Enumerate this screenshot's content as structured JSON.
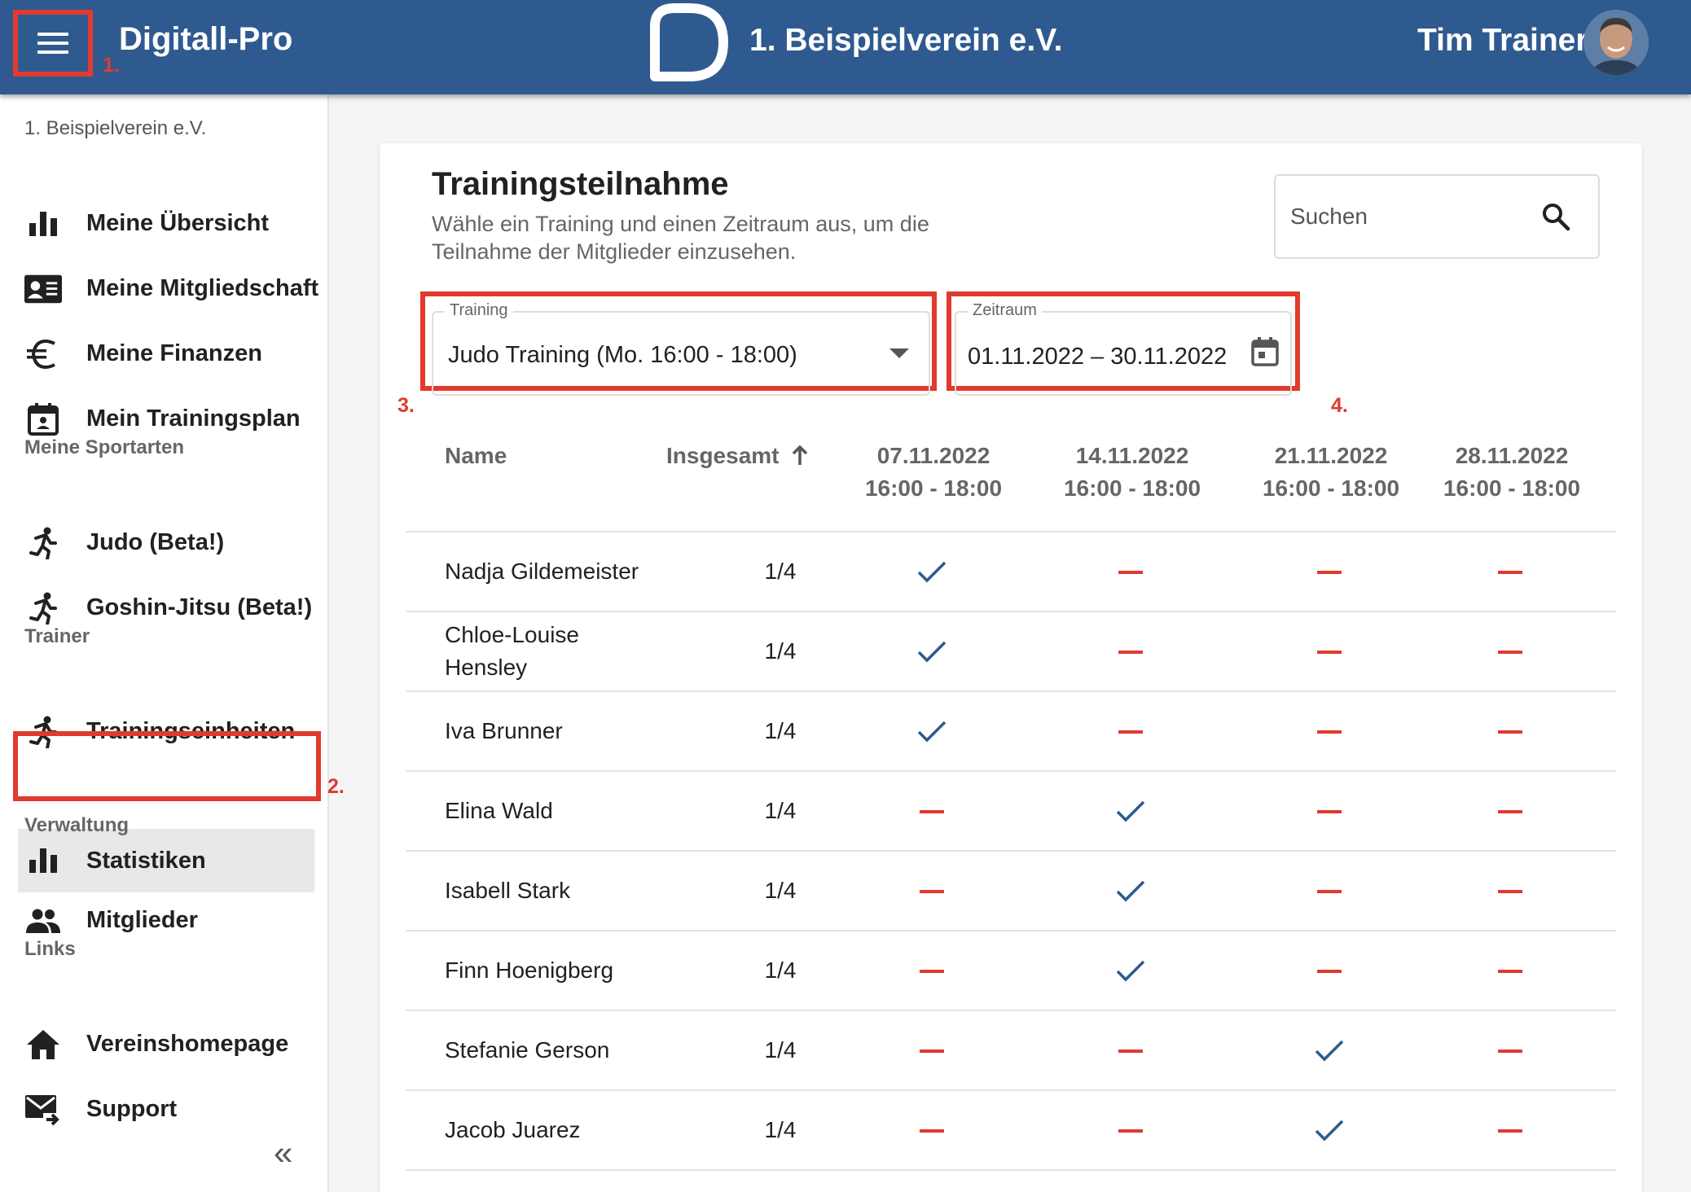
{
  "header": {
    "app_title": "Digitall-Pro",
    "club_name": "1. Beispielverein e.V.",
    "user_name": "Tim Trainer",
    "annotation_menu": "1."
  },
  "sidebar": {
    "club": "1. Beispielverein e.V.",
    "items": [
      {
        "label": "Meine Übersicht",
        "icon": "bar-chart-icon"
      },
      {
        "label": "Meine Mitgliedschaft",
        "icon": "id-card-icon"
      },
      {
        "label": "Meine Finanzen",
        "icon": "euro-icon"
      },
      {
        "label": "Mein Trainingsplan",
        "icon": "calendar-person-icon"
      }
    ],
    "section_sports": "Meine Sportarten",
    "sports": [
      {
        "label": "Judo (Beta!)",
        "icon": "runner-icon"
      },
      {
        "label": "Goshin-Jitsu (Beta!)",
        "icon": "runner-icon"
      }
    ],
    "section_trainer": "Trainer",
    "trainer": [
      {
        "label": "Trainingseinheiten",
        "icon": "runner-icon"
      },
      {
        "label": "Statistiken",
        "icon": "bar-chart-icon",
        "active": true
      }
    ],
    "annotation_active": "2.",
    "section_admin": "Verwaltung",
    "admin": [
      {
        "label": "Mitglieder",
        "icon": "people-icon"
      }
    ],
    "section_links": "Links",
    "links": [
      {
        "label": "Vereinshomepage",
        "icon": "home-icon"
      },
      {
        "label": "Support",
        "icon": "mail-send-icon"
      }
    ],
    "collapse_label": "«"
  },
  "main": {
    "title": "Trainingsteilnahme",
    "subtitle": "Wähle ein Training und einen Zeitraum aus, um die Teilnahme der Mitglieder einzusehen.",
    "search_placeholder": "Suchen",
    "training_label": "Training",
    "training_value": "Judo Training (Mo. 16:00 - 18:00)",
    "annotation_training": "3.",
    "period_label": "Zeitraum",
    "period_value": "01.11.2022 – 30.11.2022",
    "annotation_period": "4.",
    "columns": {
      "name": "Name",
      "total": "Insgesamt",
      "sort_icon": "arrow-up-icon",
      "dates": [
        {
          "date": "07.11.2022",
          "time": "16:00 - 18:00"
        },
        {
          "date": "14.11.2022",
          "time": "16:00 - 18:00"
        },
        {
          "date": "21.11.2022",
          "time": "16:00 - 18:00"
        },
        {
          "date": "28.11.2022",
          "time": "16:00 - 18:00"
        }
      ]
    },
    "rows": [
      {
        "name": "Nadja Gildemeister",
        "total": "1/4",
        "attendance": [
          true,
          false,
          false,
          false
        ]
      },
      {
        "name": "Chloe-Louise Hensley",
        "total": "1/4",
        "attendance": [
          true,
          false,
          false,
          false
        ]
      },
      {
        "name": "Iva Brunner",
        "total": "1/4",
        "attendance": [
          true,
          false,
          false,
          false
        ]
      },
      {
        "name": "Elina Wald",
        "total": "1/4",
        "attendance": [
          false,
          true,
          false,
          false
        ]
      },
      {
        "name": "Isabell Stark",
        "total": "1/4",
        "attendance": [
          false,
          true,
          false,
          false
        ]
      },
      {
        "name": "Finn Hoenigberg",
        "total": "1/4",
        "attendance": [
          false,
          true,
          false,
          false
        ]
      },
      {
        "name": "Stefanie Gerson",
        "total": "1/4",
        "attendance": [
          false,
          false,
          true,
          false
        ]
      },
      {
        "name": "Jacob Juarez",
        "total": "1/4",
        "attendance": [
          false,
          false,
          true,
          false
        ]
      }
    ]
  },
  "colors": {
    "brand": "#2f5a8f",
    "annotation": "#e13a2e",
    "check": "#2f5a8f",
    "absent": "#e13a2e"
  }
}
